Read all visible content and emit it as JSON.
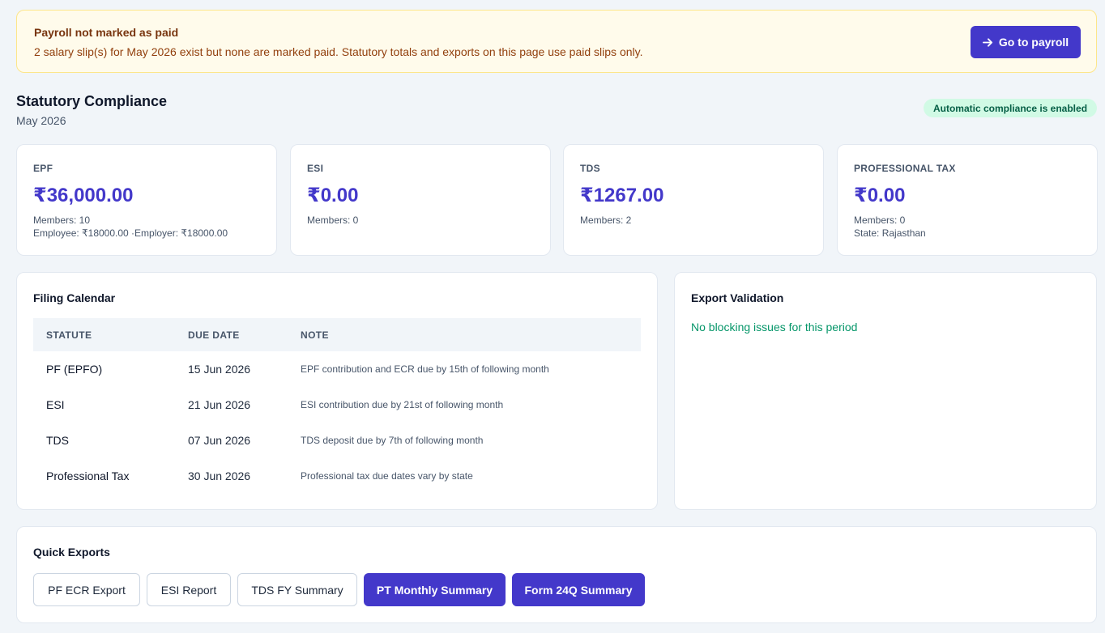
{
  "alert": {
    "title": "Payroll not marked as paid",
    "message": "2 salary slip(s) for May 2026 exist but none are marked paid. Statutory totals and exports on this page use paid slips only.",
    "action_label": "Go to payroll",
    "action_icon": "arrow-right-icon"
  },
  "header": {
    "title": "Statutory Compliance",
    "period": "May 2026",
    "badge": "Automatic compliance is enabled"
  },
  "summary": [
    {
      "label": "EPF",
      "amount": "₹36,000.00",
      "line1": "Members: 10",
      "line2": "Employee: ₹18000.00 ·Employer: ₹18000.00"
    },
    {
      "label": "ESI",
      "amount": "₹0.00",
      "line1": "Members: 0",
      "line2": ""
    },
    {
      "label": "TDS",
      "amount": "₹1267.00",
      "line1": "Members: 2",
      "line2": ""
    },
    {
      "label": "PROFESSIONAL TAX",
      "amount": "₹0.00",
      "line1": "Members: 0",
      "line2": "State: Rajasthan"
    }
  ],
  "calendar": {
    "title": "Filing Calendar",
    "columns": [
      "STATUTE",
      "DUE DATE",
      "NOTE"
    ],
    "rows": [
      {
        "statute": "PF (EPFO)",
        "due": "15 Jun 2026",
        "note": "EPF contribution and ECR due by 15th of following month"
      },
      {
        "statute": "ESI",
        "due": "21 Jun 2026",
        "note": "ESI contribution due by 21st of following month"
      },
      {
        "statute": "TDS",
        "due": "07 Jun 2026",
        "note": "TDS deposit due by 7th of following month"
      },
      {
        "statute": "Professional Tax",
        "due": "30 Jun 2026",
        "note": "Professional tax due dates vary by state"
      }
    ]
  },
  "validation": {
    "title": "Export Validation",
    "message": "No blocking issues for this period"
  },
  "exports": {
    "title": "Quick Exports",
    "buttons": [
      {
        "label": "PF ECR Export"
      },
      {
        "label": "ESI Report"
      },
      {
        "label": "TDS FY Summary"
      },
      {
        "label": "PT Monthly Summary"
      },
      {
        "label": "Form 24Q Summary"
      }
    ]
  },
  "colors": {
    "accent": "#4338ca",
    "alert_bg": "#fffbeb",
    "success": "#059669",
    "badge_bg": "#d1fae5"
  }
}
